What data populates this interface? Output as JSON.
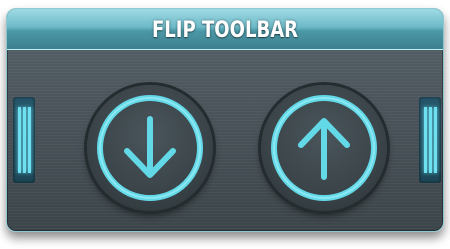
{
  "toolbar": {
    "title": "FLIP TOOLBAR",
    "buttons": [
      {
        "icon": "arrow-down-icon"
      },
      {
        "icon": "arrow-up-icon"
      }
    ]
  },
  "colors": {
    "accent": "#63d9e8",
    "title_bar": "#6db9c7",
    "panel": "#4a545a"
  }
}
